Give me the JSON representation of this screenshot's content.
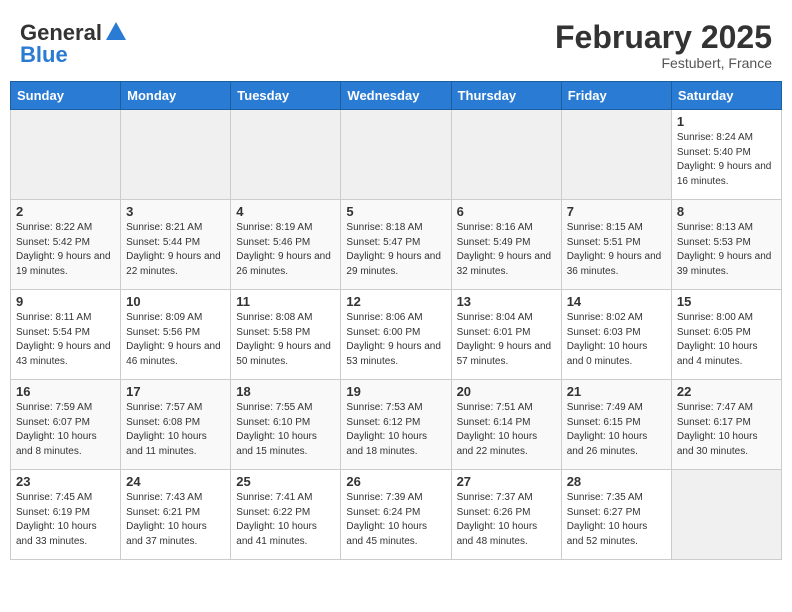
{
  "header": {
    "logo_general": "General",
    "logo_blue": "Blue",
    "month_title": "February 2025",
    "location": "Festubert, France"
  },
  "weekdays": [
    "Sunday",
    "Monday",
    "Tuesday",
    "Wednesday",
    "Thursday",
    "Friday",
    "Saturday"
  ],
  "weeks": [
    [
      {
        "day": "",
        "info": ""
      },
      {
        "day": "",
        "info": ""
      },
      {
        "day": "",
        "info": ""
      },
      {
        "day": "",
        "info": ""
      },
      {
        "day": "",
        "info": ""
      },
      {
        "day": "",
        "info": ""
      },
      {
        "day": "1",
        "info": "Sunrise: 8:24 AM\nSunset: 5:40 PM\nDaylight: 9 hours and 16 minutes."
      }
    ],
    [
      {
        "day": "2",
        "info": "Sunrise: 8:22 AM\nSunset: 5:42 PM\nDaylight: 9 hours and 19 minutes."
      },
      {
        "day": "3",
        "info": "Sunrise: 8:21 AM\nSunset: 5:44 PM\nDaylight: 9 hours and 22 minutes."
      },
      {
        "day": "4",
        "info": "Sunrise: 8:19 AM\nSunset: 5:46 PM\nDaylight: 9 hours and 26 minutes."
      },
      {
        "day": "5",
        "info": "Sunrise: 8:18 AM\nSunset: 5:47 PM\nDaylight: 9 hours and 29 minutes."
      },
      {
        "day": "6",
        "info": "Sunrise: 8:16 AM\nSunset: 5:49 PM\nDaylight: 9 hours and 32 minutes."
      },
      {
        "day": "7",
        "info": "Sunrise: 8:15 AM\nSunset: 5:51 PM\nDaylight: 9 hours and 36 minutes."
      },
      {
        "day": "8",
        "info": "Sunrise: 8:13 AM\nSunset: 5:53 PM\nDaylight: 9 hours and 39 minutes."
      }
    ],
    [
      {
        "day": "9",
        "info": "Sunrise: 8:11 AM\nSunset: 5:54 PM\nDaylight: 9 hours and 43 minutes."
      },
      {
        "day": "10",
        "info": "Sunrise: 8:09 AM\nSunset: 5:56 PM\nDaylight: 9 hours and 46 minutes."
      },
      {
        "day": "11",
        "info": "Sunrise: 8:08 AM\nSunset: 5:58 PM\nDaylight: 9 hours and 50 minutes."
      },
      {
        "day": "12",
        "info": "Sunrise: 8:06 AM\nSunset: 6:00 PM\nDaylight: 9 hours and 53 minutes."
      },
      {
        "day": "13",
        "info": "Sunrise: 8:04 AM\nSunset: 6:01 PM\nDaylight: 9 hours and 57 minutes."
      },
      {
        "day": "14",
        "info": "Sunrise: 8:02 AM\nSunset: 6:03 PM\nDaylight: 10 hours and 0 minutes."
      },
      {
        "day": "15",
        "info": "Sunrise: 8:00 AM\nSunset: 6:05 PM\nDaylight: 10 hours and 4 minutes."
      }
    ],
    [
      {
        "day": "16",
        "info": "Sunrise: 7:59 AM\nSunset: 6:07 PM\nDaylight: 10 hours and 8 minutes."
      },
      {
        "day": "17",
        "info": "Sunrise: 7:57 AM\nSunset: 6:08 PM\nDaylight: 10 hours and 11 minutes."
      },
      {
        "day": "18",
        "info": "Sunrise: 7:55 AM\nSunset: 6:10 PM\nDaylight: 10 hours and 15 minutes."
      },
      {
        "day": "19",
        "info": "Sunrise: 7:53 AM\nSunset: 6:12 PM\nDaylight: 10 hours and 18 minutes."
      },
      {
        "day": "20",
        "info": "Sunrise: 7:51 AM\nSunset: 6:14 PM\nDaylight: 10 hours and 22 minutes."
      },
      {
        "day": "21",
        "info": "Sunrise: 7:49 AM\nSunset: 6:15 PM\nDaylight: 10 hours and 26 minutes."
      },
      {
        "day": "22",
        "info": "Sunrise: 7:47 AM\nSunset: 6:17 PM\nDaylight: 10 hours and 30 minutes."
      }
    ],
    [
      {
        "day": "23",
        "info": "Sunrise: 7:45 AM\nSunset: 6:19 PM\nDaylight: 10 hours and 33 minutes."
      },
      {
        "day": "24",
        "info": "Sunrise: 7:43 AM\nSunset: 6:21 PM\nDaylight: 10 hours and 37 minutes."
      },
      {
        "day": "25",
        "info": "Sunrise: 7:41 AM\nSunset: 6:22 PM\nDaylight: 10 hours and 41 minutes."
      },
      {
        "day": "26",
        "info": "Sunrise: 7:39 AM\nSunset: 6:24 PM\nDaylight: 10 hours and 45 minutes."
      },
      {
        "day": "27",
        "info": "Sunrise: 7:37 AM\nSunset: 6:26 PM\nDaylight: 10 hours and 48 minutes."
      },
      {
        "day": "28",
        "info": "Sunrise: 7:35 AM\nSunset: 6:27 PM\nDaylight: 10 hours and 52 minutes."
      },
      {
        "day": "",
        "info": ""
      }
    ]
  ]
}
